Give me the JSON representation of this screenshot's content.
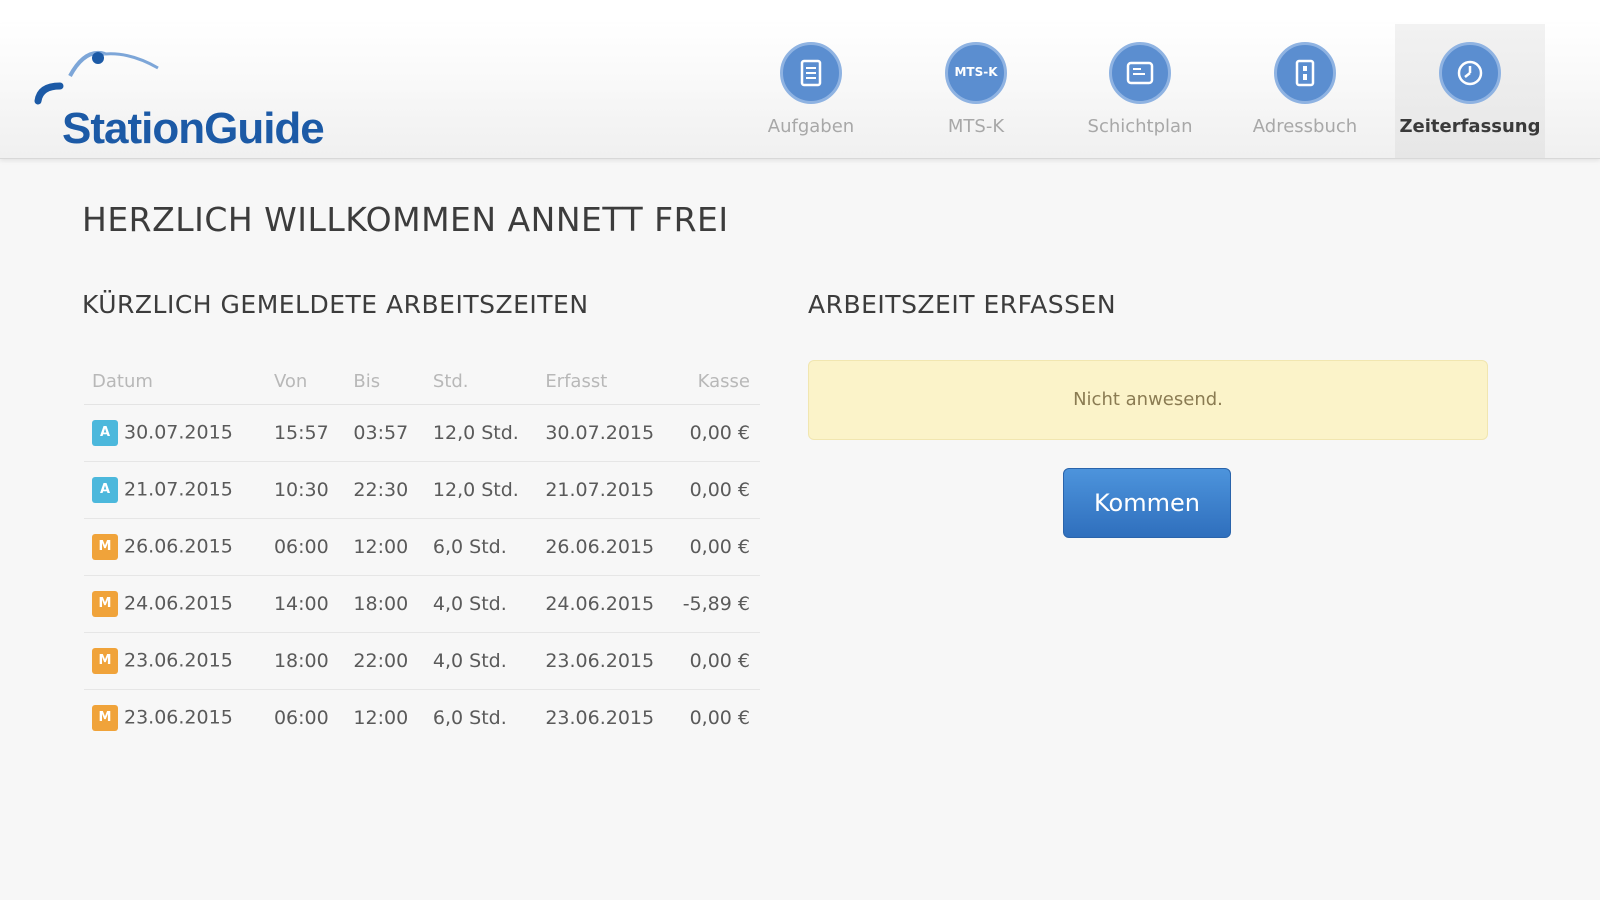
{
  "app": {
    "logo_text": "StationGuide"
  },
  "nav": {
    "items": [
      {
        "label": "Aufgaben",
        "icon": "clipboard-icon"
      },
      {
        "label": "MTS-K",
        "icon": "mts-k-icon",
        "icon_text": "MTS-K"
      },
      {
        "label": "Schichtplan",
        "icon": "calendar-icon"
      },
      {
        "label": "Adressbuch",
        "icon": "address-book-icon"
      },
      {
        "label": "Zeiterfassung",
        "icon": "clock-icon",
        "active": true
      }
    ]
  },
  "main": {
    "welcome": "HERZLICH WILLKOMMEN ANNETT FREI",
    "recent_title": "KÜRZLICH GEMELDETE ARBEITSZEITEN",
    "capture_title": "ARBEITSZEIT ERFASSEN",
    "status_text": "Nicht anwesend.",
    "button_label": "Kommen"
  },
  "table": {
    "headers": [
      "Datum",
      "Von",
      "Bis",
      "Std.",
      "Erfasst",
      "Kasse"
    ],
    "rows": [
      {
        "badge": "A",
        "badge_color": "#4cb8dc",
        "date": "30.07.2015",
        "from": "15:57",
        "to": "03:57",
        "hours": "12,0 Std.",
        "captured": "30.07.2015",
        "cash": "0,00 €"
      },
      {
        "badge": "A",
        "badge_color": "#4cb8dc",
        "date": "21.07.2015",
        "from": "10:30",
        "to": "22:30",
        "hours": "12,0 Std.",
        "captured": "21.07.2015",
        "cash": "0,00 €"
      },
      {
        "badge": "M",
        "badge_color": "#f0a33a",
        "date": "26.06.2015",
        "from": "06:00",
        "to": "12:00",
        "hours": "6,0 Std.",
        "captured": "26.06.2015",
        "cash": "0,00 €"
      },
      {
        "badge": "M",
        "badge_color": "#f0a33a",
        "date": "24.06.2015",
        "from": "14:00",
        "to": "18:00",
        "hours": "4,0 Std.",
        "captured": "24.06.2015",
        "cash": "-5,89 €"
      },
      {
        "badge": "M",
        "badge_color": "#f0a33a",
        "date": "23.06.2015",
        "from": "18:00",
        "to": "22:00",
        "hours": "4,0 Std.",
        "captured": "23.06.2015",
        "cash": "0,00 €"
      },
      {
        "badge": "M",
        "badge_color": "#f0a33a",
        "date": "23.06.2015",
        "from": "06:00",
        "to": "12:00",
        "hours": "6,0 Std.",
        "captured": "23.06.2015",
        "cash": "0,00 €"
      }
    ]
  },
  "colors": {
    "brand": "#1c5aa6",
    "nav_icon": "#5b8ed0",
    "status_bg": "#fbf3c9",
    "button": "#3a7fcc"
  }
}
